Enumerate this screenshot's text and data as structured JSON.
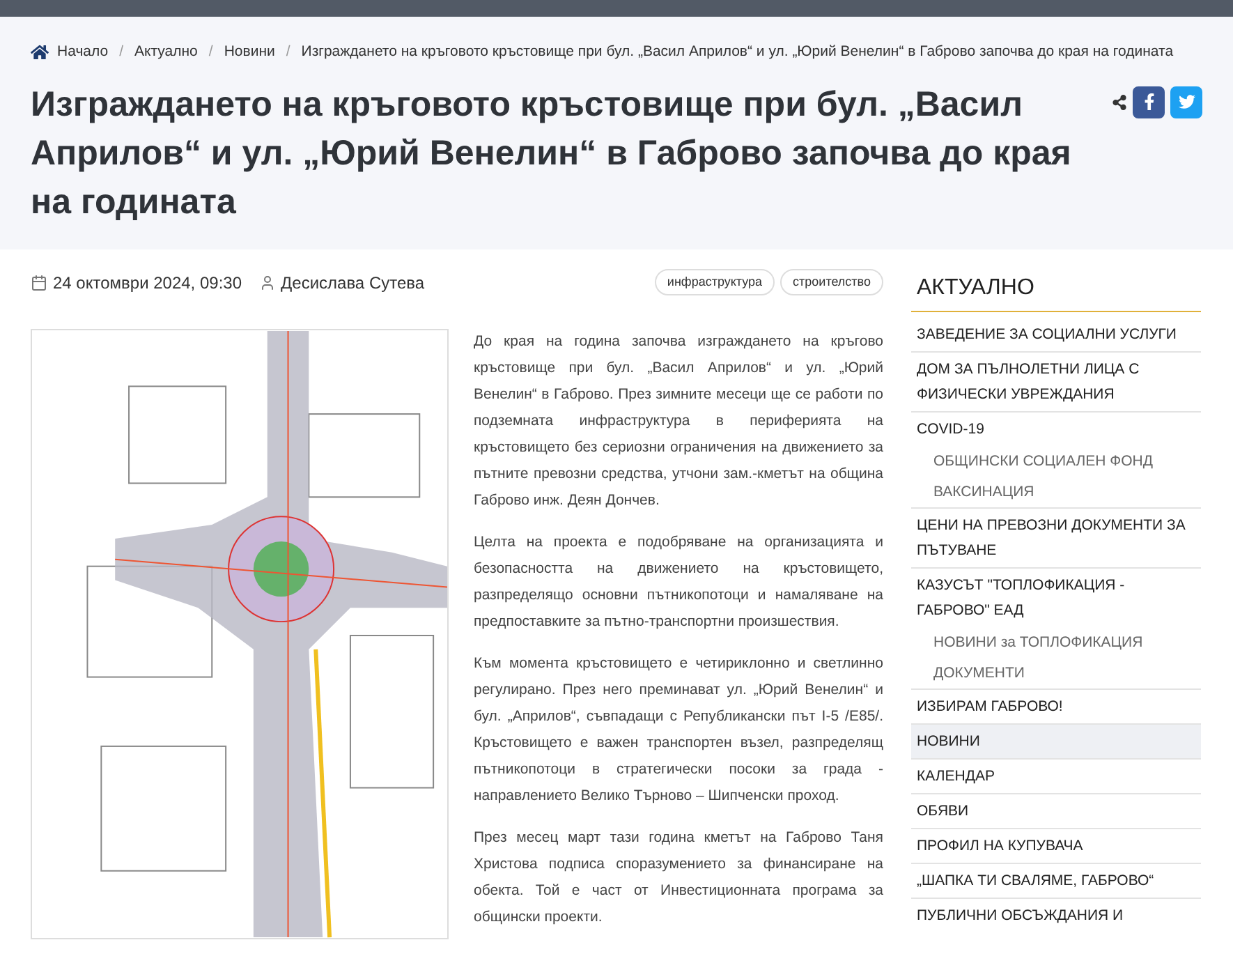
{
  "breadcrumb_separator": "/",
  "breadcrumb": [
    {
      "label": "Начало",
      "kind": "home"
    },
    {
      "label": "Актуално",
      "kind": "link"
    },
    {
      "label": "Новини",
      "kind": "link"
    },
    {
      "label": "Изграждането на кръговото кръстовище при бул. „Васил Априлов“ и ул. „Юрий Венелин“ в Габрово започва до края на годината",
      "kind": "current"
    }
  ],
  "article": {
    "title": "Изграждането на кръговото кръстовище при бул. „Васил Априлов“ и ул. „Юрий Венелин“ в Габрово започва до края на годината",
    "date": "24 октомври 2024, 09:30",
    "author": "Десислава Сутева",
    "tags": [
      "инфраструктура",
      "строителство"
    ],
    "paragraphs": [
      "До края на година започва изграждането на кръгово кръстовище при бул. „Васил Априлов“ и ул. „Юрий Венелин“ в Габрово. През зимните месеци ще се работи по подземната инфраструктура в периферията на кръстовището без сериозни ограничения на движението за пътните превозни средства, утчони зам.-кметът на община Габрово инж. Деян Дончев.",
      "Целта на проекта е подобряване на организацията и безопасността на движението на кръстовището, разпределящо основни пътникопотоци и намаляване на предпоставките за пътно-транспортни произшествия.",
      "Към момента кръстовището е четириклонно и светлинно регулирано. През него преминават ул. „Юрий Венелин“ и бул. „Априлов“, съвпадащи с Републикански път I-5 /E85/. Кръстовището е важен транспортен възел, разпределящ пътникопотоци в стратегически посоки за града - направлението Велико Търново – Шипченски проход.",
      "През месец март тази година кметът на Габрово Таня Христова подписа споразумението за финансиране на обекта. Той е част от Инвестиционната програма за общински проекти."
    ]
  },
  "sidebar": {
    "title": "АКТУАЛНО",
    "items": [
      {
        "label": "ЗАВЕДЕНИЕ ЗА СОЦИАЛНИ УСЛУГИ",
        "selected": false
      },
      {
        "label": "ДОМ ЗА ПЪЛНОЛЕТНИ ЛИЦА С ФИЗИЧЕСКИ УВРЕЖДАНИЯ",
        "selected": false
      },
      {
        "label": "COVID-19",
        "selected": false,
        "children": [
          {
            "label": "ОБЩИНСКИ СОЦИАЛЕН ФОНД",
            "selected": false
          },
          {
            "label": "ВАКСИНАЦИЯ",
            "selected": false
          }
        ]
      },
      {
        "label": "ЦЕНИ НА ПРЕВОЗНИ ДОКУМЕНТИ ЗА ПЪТУВАНЕ",
        "selected": false
      },
      {
        "label": "КАЗУСЪТ \"ТОПЛОФИКАЦИЯ - ГАБРОВО\" ЕАД",
        "selected": false,
        "children": [
          {
            "label": "НОВИНИ за ТОПЛОФИКАЦИЯ",
            "selected": false
          },
          {
            "label": "ДОКУМЕНТИ",
            "selected": false
          }
        ]
      },
      {
        "label": "ИЗБИРАМ ГАБРОВО!",
        "selected": false
      },
      {
        "label": "НОВИНИ",
        "selected": true
      },
      {
        "label": "КАЛЕНДАР",
        "selected": false
      },
      {
        "label": "ОБЯВИ",
        "selected": false
      },
      {
        "label": "ПРОФИЛ НА КУПУВАЧА",
        "selected": false
      },
      {
        "label": "„ШАПКА ТИ СВАЛЯМЕ, ГАБРОВО“",
        "selected": false
      },
      {
        "label": "ПУБЛИЧНИ ОБСЪЖДАНИЯ И",
        "selected": false
      }
    ]
  }
}
